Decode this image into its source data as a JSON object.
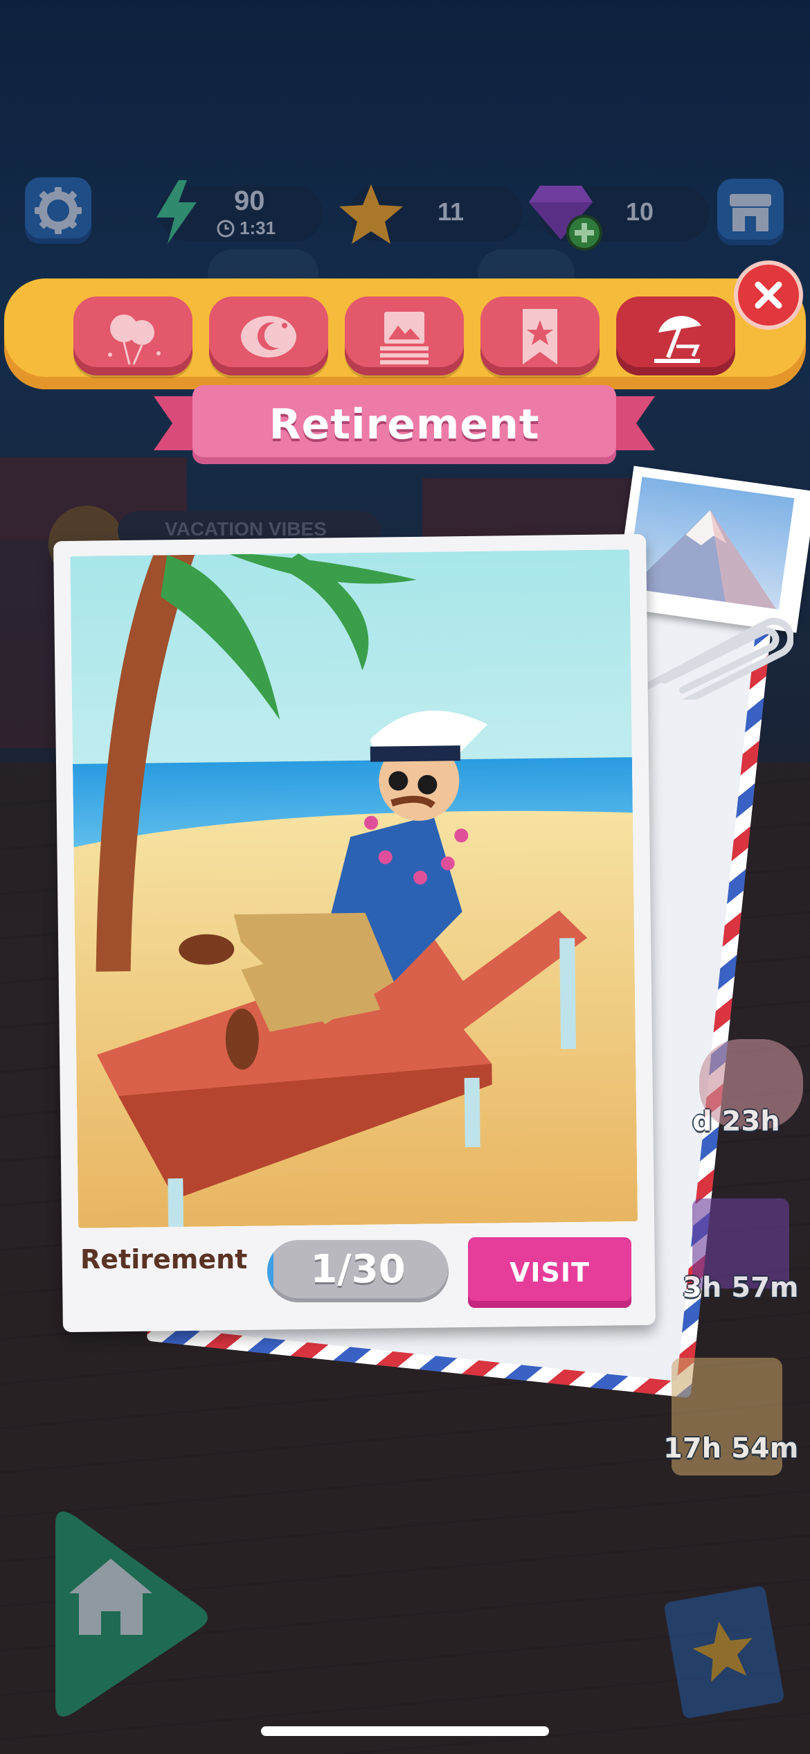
{
  "hud": {
    "energy": "90",
    "energy_timer": "1:31",
    "stars": "11",
    "gems": "10"
  },
  "categories": [
    "balloons-icon",
    "moon-icon",
    "album-icon",
    "bookmark-star-icon",
    "beach-umbrella-icon"
  ],
  "category_title": "Retirement",
  "background_label": "VACATION VIBES",
  "card": {
    "title": "Retirement",
    "progress_text": "1/30",
    "progress_fraction": 0.0333,
    "visit_label": "VISIT"
  },
  "side_timers": {
    "piggy": "d 23h",
    "gift": "3h 57m",
    "calendar": "17h 54m"
  },
  "colors": {
    "category_bar": "#f6bb3a",
    "category_button": "#e3586b",
    "ribbon": "#ed7ba7",
    "visit_button": "#e63d9a",
    "close_button": "#e2373c"
  }
}
